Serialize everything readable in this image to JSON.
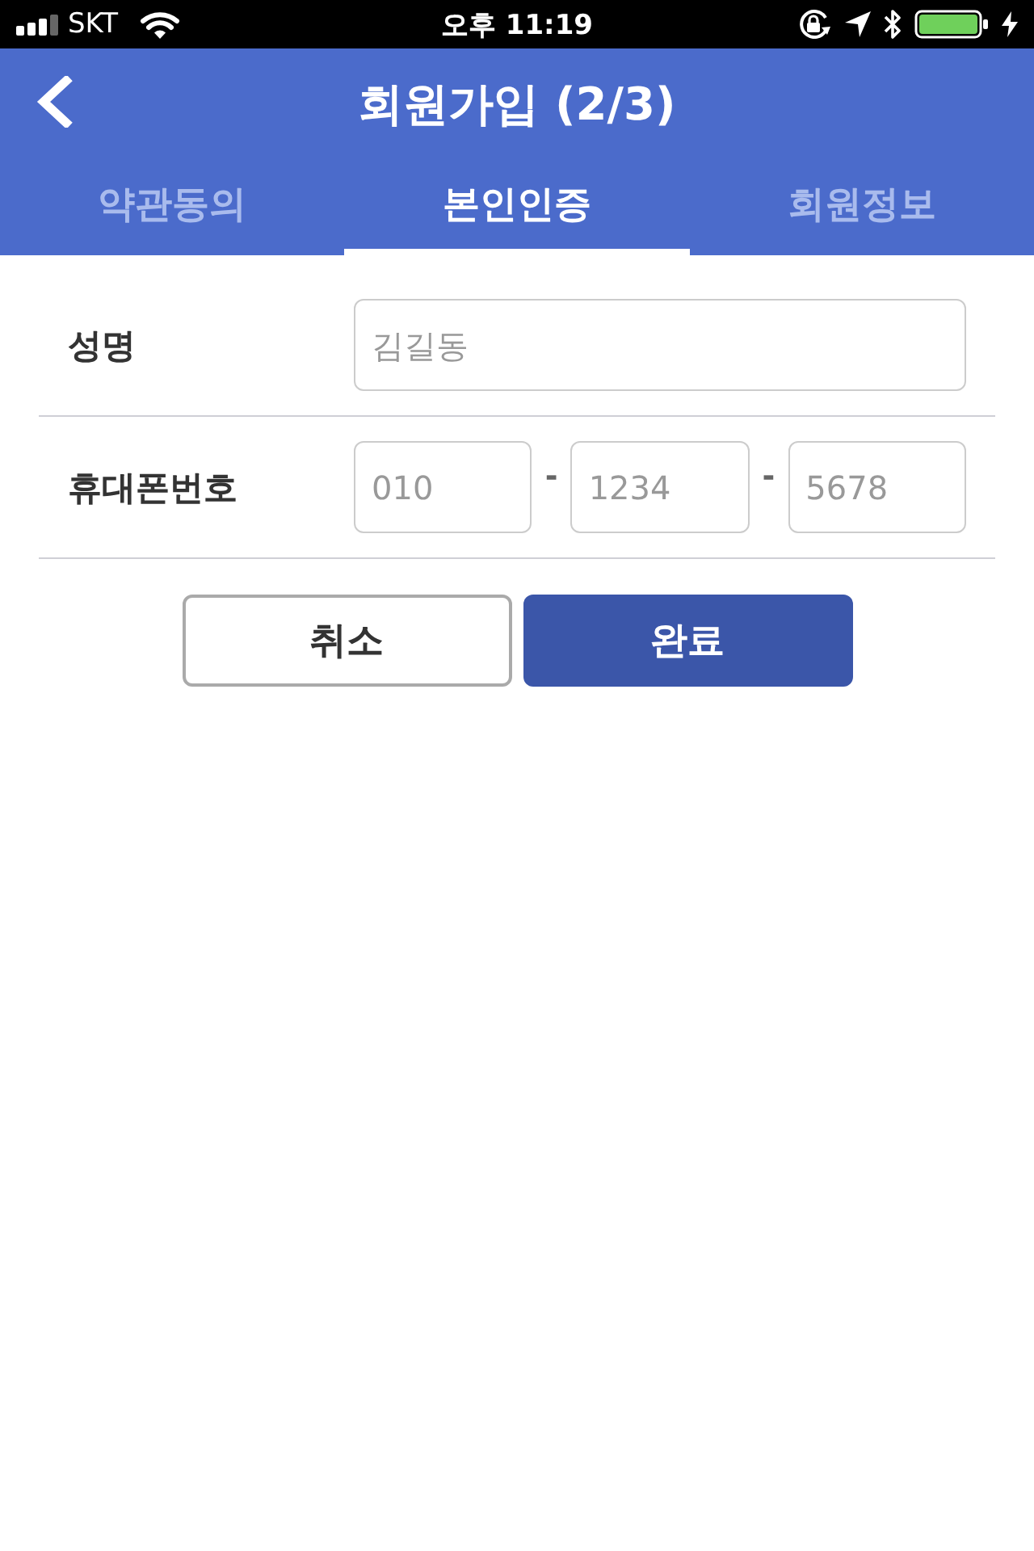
{
  "status_bar": {
    "carrier": "SKT",
    "time": "오후 11:19"
  },
  "header": {
    "title": "회원가입 (2/3)"
  },
  "tabs": [
    {
      "label": "약관동의",
      "selected": false
    },
    {
      "label": "본인인증",
      "selected": true
    },
    {
      "label": "회원정보",
      "selected": false
    }
  ],
  "form": {
    "rows": [
      {
        "label": "성명",
        "fields": [
          {
            "placeholder": "김길동"
          }
        ],
        "separators": []
      },
      {
        "label": "휴대폰번호",
        "fields": [
          {
            "placeholder": "010"
          },
          {
            "placeholder": "1234"
          },
          {
            "placeholder": "5678"
          }
        ],
        "separators": [
          "-",
          "-"
        ]
      }
    ]
  },
  "buttons": [
    {
      "label": "취소",
      "kind": "secondary"
    },
    {
      "label": "완료",
      "kind": "primary"
    }
  ]
}
